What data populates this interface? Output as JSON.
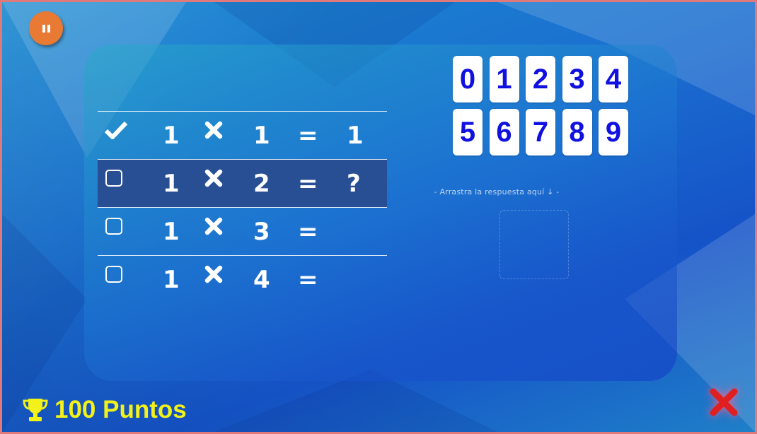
{
  "colors": {
    "accent_orange": "#e87a33",
    "tile_text": "#1010e0",
    "score_yellow": "#f2f21a",
    "close_red": "#e02020",
    "active_row": "#284f94"
  },
  "pause_button": {
    "icon": "pause-icon"
  },
  "number_tiles": [
    "0",
    "1",
    "2",
    "3",
    "4",
    "5",
    "6",
    "7",
    "8",
    "9"
  ],
  "drop_hint": "- Arrastra la respuesta aquí ↓ -",
  "rows": [
    {
      "status": "done",
      "status_icon": "checkmark-icon",
      "a": "1",
      "op": "multiply-icon",
      "b": "1",
      "eq": "=",
      "answer": "1"
    },
    {
      "status": "current",
      "status_icon": "checkbox-icon",
      "a": "1",
      "op": "multiply-icon",
      "b": "2",
      "eq": "=",
      "answer": "?"
    },
    {
      "status": "pending",
      "status_icon": "checkbox-icon",
      "a": "1",
      "op": "multiply-icon",
      "b": "3",
      "eq": "=",
      "answer": ""
    },
    {
      "status": "pending",
      "status_icon": "checkbox-icon",
      "a": "1",
      "op": "multiply-icon",
      "b": "4",
      "eq": "=",
      "answer": ""
    }
  ],
  "score": {
    "icon": "trophy-icon",
    "label": "100 Puntos"
  },
  "close_button": {
    "icon": "close-icon"
  }
}
